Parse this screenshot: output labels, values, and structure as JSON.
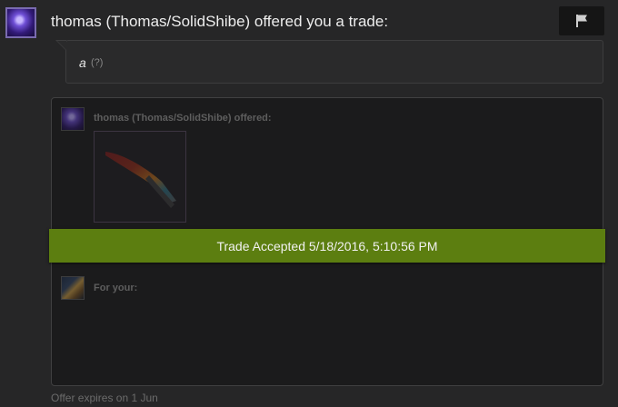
{
  "header": {
    "title": "thomas (Thomas/SolidShibe) offered you a trade:",
    "flag_icon": "flag-icon"
  },
  "message": {
    "text": "a",
    "hint": "(?)"
  },
  "trade": {
    "offered_label": "thomas (Thomas/SolidShibe) offered:",
    "item_icon": "knife-item-icon",
    "accepted_text": "Trade Accepted 5/18/2016, 5:10:56 PM",
    "accepted_color": "#5c7e10",
    "for_your_label": "For your:"
  },
  "footer": {
    "expires_text": "Offer expires on 1 Jun"
  }
}
